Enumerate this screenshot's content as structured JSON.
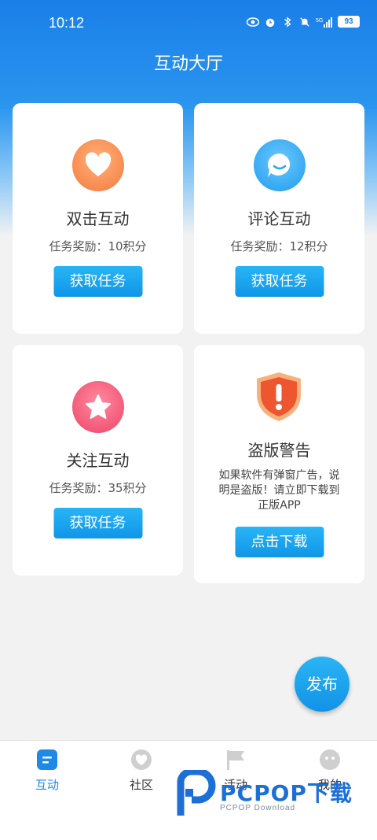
{
  "status_bar": {
    "time": "10:12",
    "battery": "93",
    "icons": [
      "eye-icon",
      "alarm-icon",
      "bluetooth-icon",
      "mute-icon",
      "signal-5g-icon",
      "battery-icon"
    ]
  },
  "header": {
    "title": "互动大厅"
  },
  "cards": [
    {
      "title": "双击互动",
      "reward": "任务奖励：10积分",
      "button": "获取任务",
      "icon": "heart-icon",
      "color": "#f7844b"
    },
    {
      "title": "评论互动",
      "reward": "任务奖励：12积分",
      "button": "获取任务",
      "icon": "comment-icon",
      "color": "#2ba8f3"
    },
    {
      "title": "关注互动",
      "reward": "任务奖励：35积分",
      "button": "获取任务",
      "icon": "star-icon",
      "color": "#f04f6d"
    }
  ],
  "warning_card": {
    "title": "盗版警告",
    "desc_line1": "如果软件有弹窗广告，说",
    "desc_line2": "明是盗版！请立即下载到",
    "desc_line3": "正版APP",
    "button": "点击下载",
    "icon": "shield-warning-icon"
  },
  "fab": {
    "label": "发布"
  },
  "tabbar": {
    "items": [
      {
        "label": "互动",
        "icon": "interaction-icon",
        "active": true
      },
      {
        "label": "社区",
        "icon": "community-icon",
        "active": false
      },
      {
        "label": "活动",
        "icon": "flag-icon",
        "active": false
      },
      {
        "label": "我的",
        "icon": "profile-icon",
        "active": false
      }
    ]
  },
  "watermark": {
    "brand": "PCPOP下载",
    "sub": "PCPOP Download"
  },
  "colors": {
    "accent": "#1c8ae6",
    "button": "#0f96e8"
  }
}
